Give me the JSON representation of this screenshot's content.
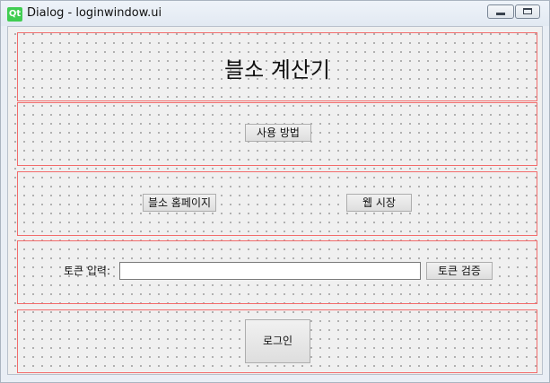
{
  "window": {
    "title": "Dialog - loginwindow.ui",
    "logo_text": "Qt"
  },
  "main": {
    "title": "블소 계산기",
    "usage_button": "사용 방법",
    "homepage_button": "블소 홈페이지",
    "webmarket_button": "웹 시장",
    "token_label": "토큰 입력:",
    "token_value": "",
    "verify_button": "토큰 검증",
    "login_button": "로그인"
  },
  "colors": {
    "layout_frame": "#f26c6c",
    "qt_logo": "#41cd52"
  }
}
